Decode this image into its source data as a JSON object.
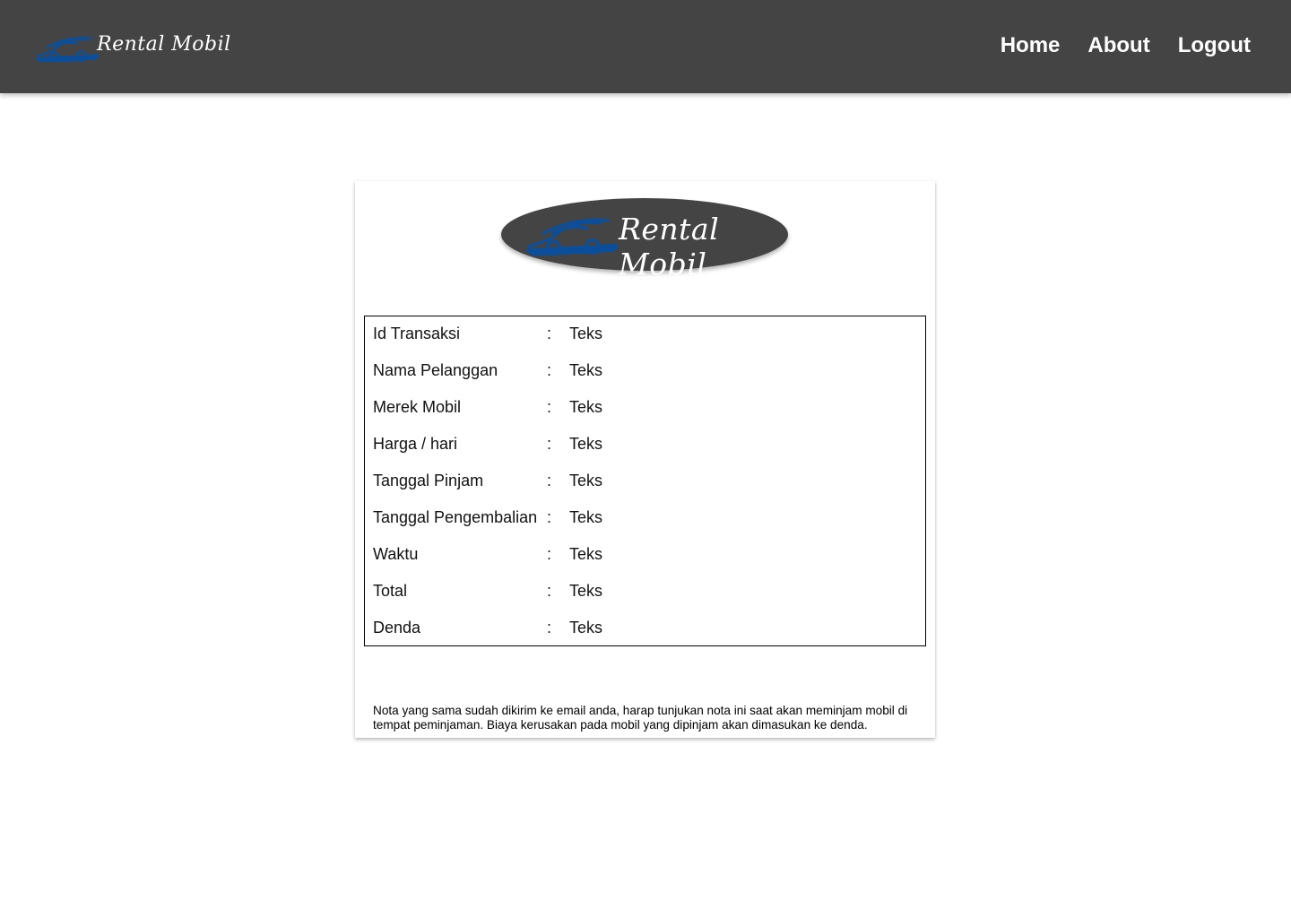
{
  "brand": {
    "name": "Rental Mobil",
    "logo_icon": "car-icon",
    "logo_colors": {
      "car": "#0b4f9c",
      "badge": "#444444"
    }
  },
  "nav": {
    "items": [
      {
        "label": "Home"
      },
      {
        "label": "About"
      },
      {
        "label": "Logout"
      }
    ]
  },
  "receipt": {
    "separator": ":",
    "rows": [
      {
        "label": "Id Transaksi",
        "value": "Teks"
      },
      {
        "label": "Nama Pelanggan",
        "value": "Teks"
      },
      {
        "label": "Merek Mobil",
        "value": "Teks"
      },
      {
        "label": "Harga / hari",
        "value": "Teks"
      },
      {
        "label": "Tanggal Pinjam",
        "value": "Teks"
      },
      {
        "label": "Tanggal Pengembalian",
        "value": "Teks"
      },
      {
        "label": "Waktu",
        "value": "Teks"
      },
      {
        "label": "Total",
        "value": "Teks"
      },
      {
        "label": "Denda",
        "value": "Teks"
      }
    ],
    "note": "Nota yang sama sudah dikirim ke email anda, harap tunjukan nota ini saat akan meminjam mobil di tempat peminjaman. Biaya kerusakan pada mobil yang dipinjam akan dimasukan ke denda."
  }
}
